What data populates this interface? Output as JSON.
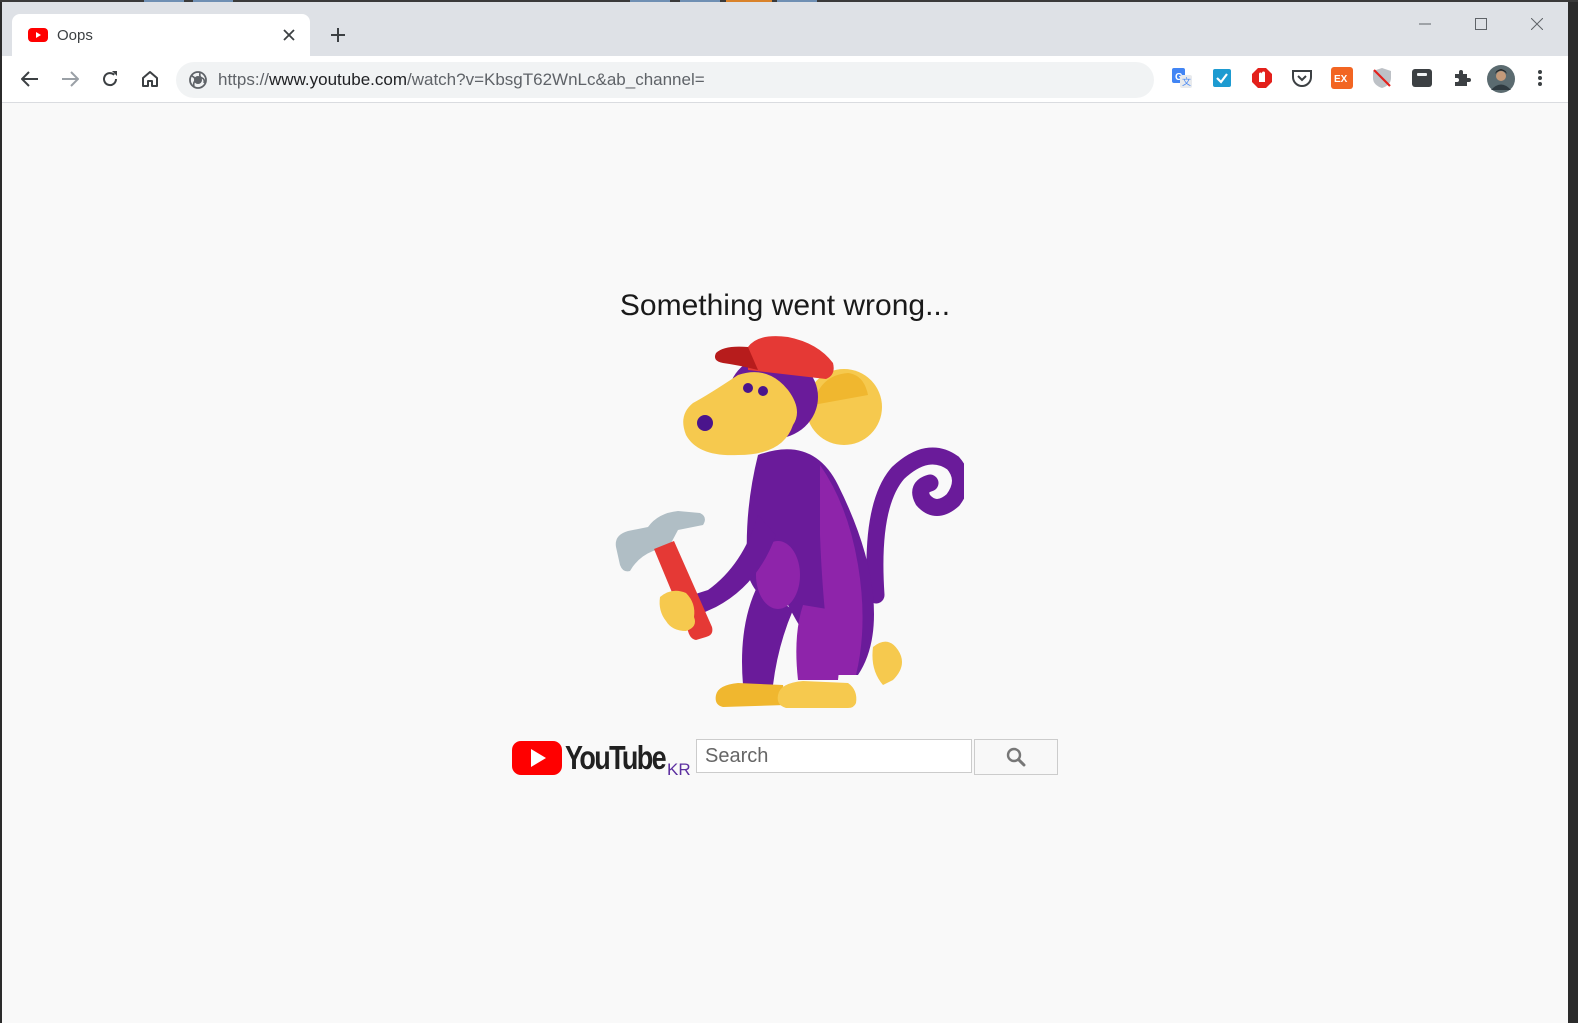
{
  "browser": {
    "tab": {
      "title": "Oops",
      "favicon": "youtube-favicon",
      "close_icon": "close-icon"
    },
    "new_tab_icon": "plus-icon",
    "window_controls": [
      "minimize-icon",
      "maximize-icon",
      "close-icon"
    ],
    "nav": [
      "back-icon",
      "forward-icon",
      "reload-icon",
      "home-icon"
    ],
    "address": {
      "scheme": "https://",
      "host": "www.youtube.com",
      "path": "/watch?v=KbsgT62WnLc&ab_channel="
    },
    "extensions": [
      "google-translate-icon",
      "checkbox-extension-icon",
      "adblock-icon",
      "pocket-icon",
      "ex-extension-icon",
      "shield-extension-icon",
      "dark-extension-icon",
      "puzzle-icon",
      "profile-avatar",
      "menu-dots-icon"
    ],
    "colors": {
      "tab_strip": "#dee1e6",
      "toolbar": "#ffffff",
      "omnibox": "#f1f3f4"
    }
  },
  "page": {
    "error_title": "Something went wrong...",
    "illustration": "monkey-with-hammer",
    "logo_country": "KR",
    "search": {
      "placeholder": "Search",
      "button_icon": "search-icon"
    },
    "colors": {
      "background": "#f9f9f9",
      "youtube_red": "#ff0000"
    }
  }
}
